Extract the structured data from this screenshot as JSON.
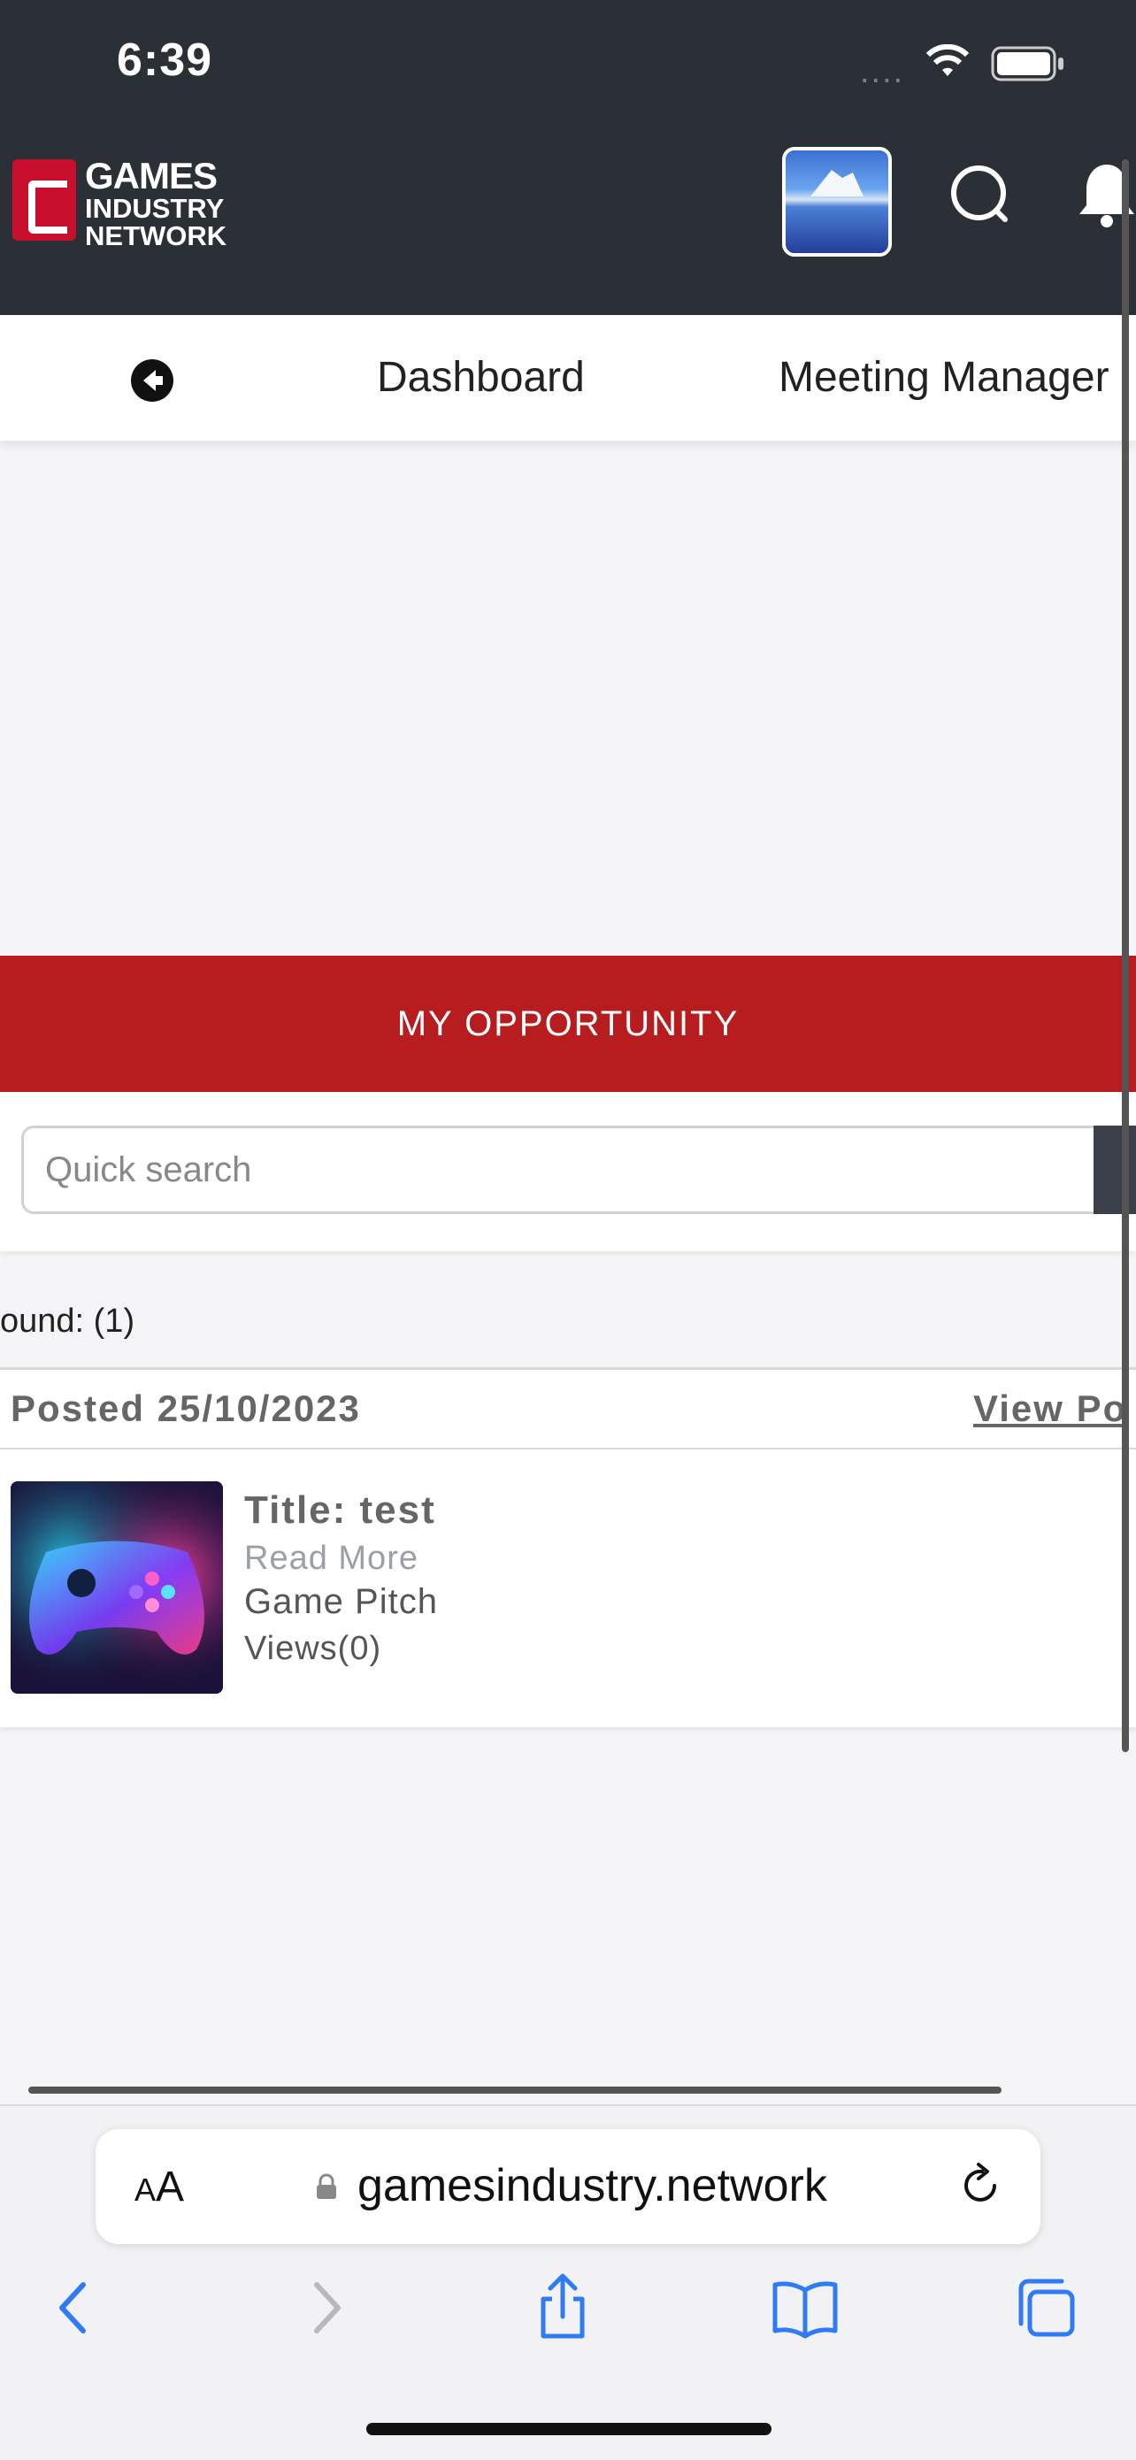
{
  "status_bar": {
    "time": "6:39",
    "signal": "....",
    "icons": [
      "wifi-icon",
      "battery-icon"
    ]
  },
  "header": {
    "logo_lines": [
      "GAMES",
      "INDUSTRY",
      "NETWORK"
    ],
    "icons": [
      "search-icon",
      "bell-icon"
    ]
  },
  "nav": {
    "items": [
      "Dashboard",
      "Meeting Manager"
    ]
  },
  "banner": {
    "title": "MY OPPORTUNITY"
  },
  "search": {
    "placeholder": "Quick search"
  },
  "results": {
    "found_label": "ound: (1)"
  },
  "post": {
    "posted": "Posted 25/10/2023",
    "view_link": "View Po",
    "title": "Title: test",
    "read_more": "Read More",
    "category": "Game Pitch",
    "views": "Views(0)"
  },
  "safari": {
    "aa_small": "A",
    "aa_large": "A",
    "url": "gamesindustry.network"
  },
  "colors": {
    "header": "#2b2f36",
    "banner": "#b71c1e",
    "link_blue": "#2f7bf6"
  }
}
